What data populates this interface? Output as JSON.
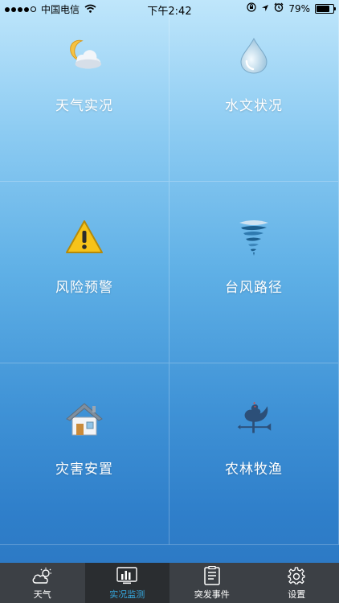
{
  "status": {
    "carrier": "中国电信",
    "time": "下午2:42",
    "battery": "79%",
    "battery_level": 0.79
  },
  "tiles": [
    {
      "label": "天气实况",
      "icon": "moon-cloud-icon"
    },
    {
      "label": "水文状况",
      "icon": "water-drop-icon"
    },
    {
      "label": "风险预警",
      "icon": "warning-triangle-icon"
    },
    {
      "label": "台风路径",
      "icon": "typhoon-icon"
    },
    {
      "label": "灾害安置",
      "icon": "house-icon"
    },
    {
      "label": "农林牧渔",
      "icon": "rooster-weathervane-icon"
    }
  ],
  "tabs": [
    {
      "label": "天气",
      "icon": "weather-cloud-icon",
      "active": false
    },
    {
      "label": "实况监测",
      "icon": "chart-monitor-icon",
      "active": true
    },
    {
      "label": "突发事件",
      "icon": "document-icon",
      "active": false
    },
    {
      "label": "设置",
      "icon": "gear-icon",
      "active": false
    }
  ],
  "colors": {
    "active_tab_text": "#36a9e1",
    "tabbar_bg": "#3c4045"
  }
}
